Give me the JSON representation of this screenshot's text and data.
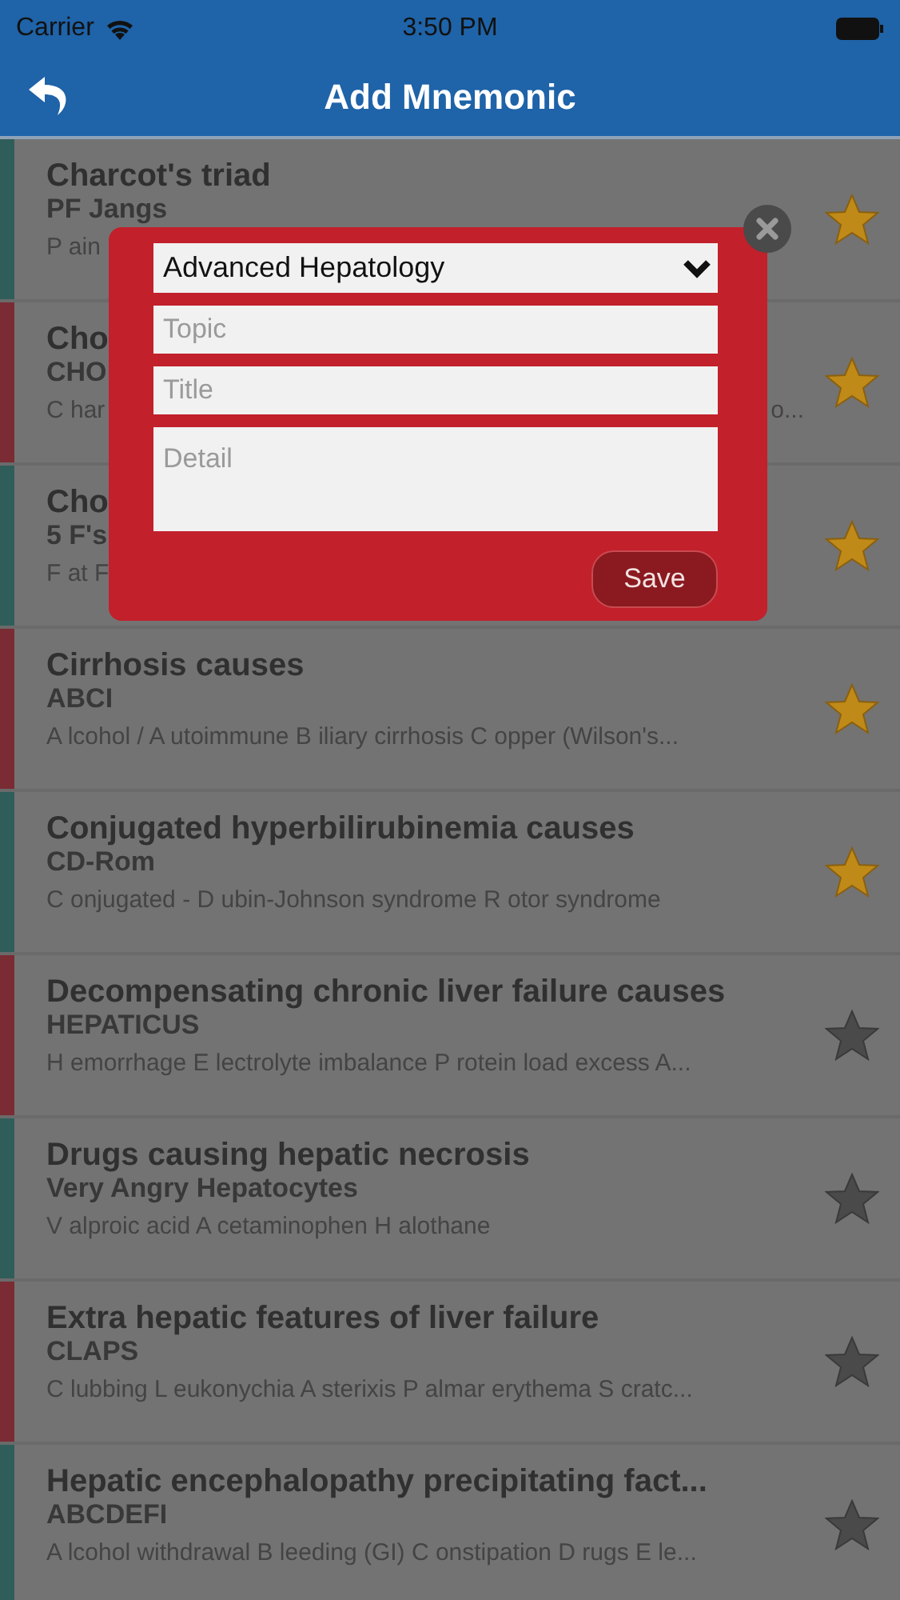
{
  "status_bar": {
    "carrier": "Carrier",
    "time": "3:50 PM"
  },
  "nav": {
    "title": "Add Mnemonic"
  },
  "rows": [
    {
      "title": "Charcot's triad",
      "subtitle": "PF Jangs",
      "detail": "P ain",
      "color": "#2f5e5a",
      "favorite": true
    },
    {
      "title": "Cho",
      "subtitle": "CHO",
      "detail": "C har",
      "detail_end": "o...",
      "color": "#7a2b33",
      "favorite": true
    },
    {
      "title": "Cho",
      "subtitle": "5 F's",
      "detail": "F at F",
      "color": "#2f5e5a",
      "favorite": true
    },
    {
      "title": "Cirrhosis causes",
      "subtitle": "ABCI",
      "detail": "A lcohol / A utoimmune B iliary cirrhosis C opper (Wilson's...",
      "color": "#7a2b33",
      "favorite": true
    },
    {
      "title": "Conjugated hyperbilirubinemia causes",
      "subtitle": "CD-Rom",
      "detail": "C onjugated - D ubin-Johnson syndrome R otor syndrome",
      "color": "#2f5e5a",
      "favorite": true
    },
    {
      "title": "Decompensating chronic liver failure causes",
      "subtitle": "HEPATICUS",
      "detail": "H emorrhage E lectrolyte imbalance P rotein load excess A...",
      "color": "#7a2b33",
      "favorite": false
    },
    {
      "title": "Drugs causing hepatic necrosis",
      "subtitle": "Very Angry Hepatocytes",
      "detail": "V alproic acid A cetaminophen H alothane",
      "color": "#2f5e5a",
      "favorite": false
    },
    {
      "title": "Extra hepatic features of liver failure",
      "subtitle": "CLAPS",
      "detail": "C lubbing L eukonychia A sterixis P almar erythema S cratc...",
      "color": "#7a2b33",
      "favorite": false
    },
    {
      "title": "Hepatic encephalopathy precipitating fact...",
      "subtitle": "ABCDEFI",
      "detail": "A lcohol withdrawal B leeding (GI) C onstipation D rugs E le...",
      "color": "#2f5e5a",
      "favorite": false
    }
  ],
  "dialog": {
    "category": "Advanced Hepatology",
    "topic": {
      "placeholder": "Topic"
    },
    "title": {
      "placeholder": "Title"
    },
    "detail": {
      "placeholder": "Detail"
    },
    "save": "Save"
  }
}
